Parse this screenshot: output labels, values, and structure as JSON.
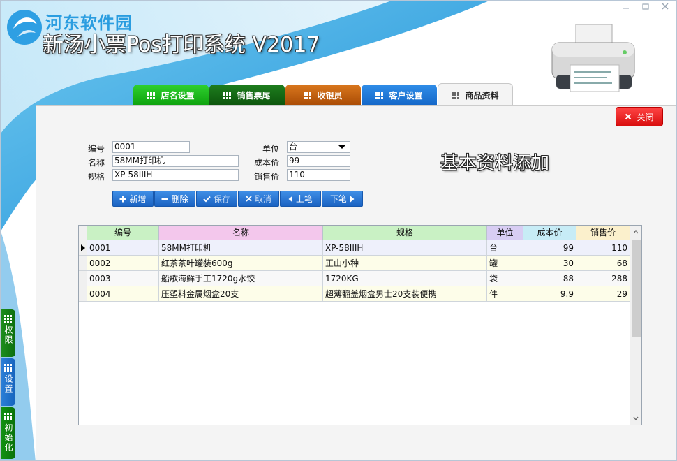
{
  "window": {
    "watermark": "河东软件园",
    "title": "新汤小票Pos打印系统 V2017",
    "controls": [
      "minimize-icon",
      "restore-icon",
      "close-icon"
    ]
  },
  "tabs": [
    {
      "label": "店名设置",
      "color": "#12b812"
    },
    {
      "label": "销售票尾",
      "color": "#0f6a0f"
    },
    {
      "label": "收银员",
      "color": "#c25f0b"
    },
    {
      "label": "客户设置",
      "color": "#1f78d6"
    },
    {
      "label": "商品资料",
      "color": "#f4f4f4",
      "active": true
    }
  ],
  "close_button": {
    "label": "关闭",
    "color": "#e21b1b"
  },
  "form": {
    "code_label": "编号",
    "code_value": "0001",
    "name_label": "名称",
    "name_value": "58MM打印机",
    "spec_label": "规格",
    "spec_value": "XP-58IIIH",
    "unit_label": "单位",
    "unit_value": "台",
    "cost_label": "成本价",
    "cost_value": "99",
    "price_label": "销售价",
    "price_value": "110"
  },
  "caption": "基本资料添加",
  "toolbar": [
    {
      "label": "新增",
      "icon": "plus-icon"
    },
    {
      "label": "删除",
      "icon": "minus-icon"
    },
    {
      "label": "保存",
      "icon": "check-icon"
    },
    {
      "label": "取消",
      "icon": "x-icon"
    },
    {
      "label": "上笔",
      "icon": "arrow-left-icon"
    },
    {
      "label": "下笔",
      "icon": "arrow-right-icon"
    }
  ],
  "table": {
    "columns": [
      "编号",
      "名称",
      "规格",
      "单位",
      "成本价",
      "销售价"
    ],
    "header_colors": [
      "#c9f1c4",
      "#f3c7ec",
      "#c9f1c4",
      "#d8cdf3",
      "#c7ecf6",
      "#fbf0cc"
    ],
    "rows": [
      [
        "0001",
        "58MM打印机",
        "XP-58IIIH",
        "台",
        "99",
        "110"
      ],
      [
        "0002",
        "红茶茶叶罐装600g",
        "正山小种",
        "罐",
        "30",
        "68"
      ],
      [
        "0003",
        "船歌海鲜手工1720g水饺",
        "1720KG",
        "袋",
        "88",
        "288"
      ],
      [
        "0004",
        "压塑料金属烟盒20支",
        "超薄翻盖烟盒男士20支装便携",
        "件",
        "9.9",
        "29"
      ]
    ],
    "selected_row": 0
  },
  "side_buttons": [
    {
      "label": "权限"
    },
    {
      "label": "设置"
    },
    {
      "label": "初始化"
    }
  ]
}
